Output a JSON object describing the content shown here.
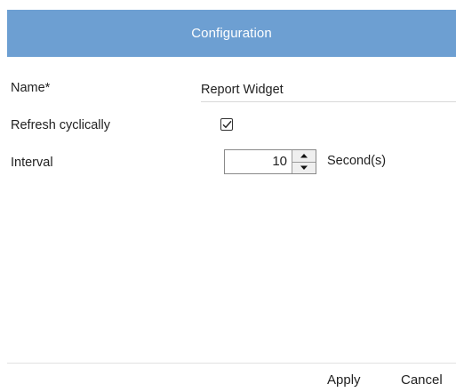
{
  "dialog": {
    "title": "Configuration",
    "header_color": "#6d9fd2"
  },
  "form": {
    "name_label": "Name*",
    "name_value": "Report Widget",
    "refresh_label": "Refresh cyclically",
    "refresh_checked": true,
    "interval_label": "Interval",
    "interval_value": "10",
    "interval_unit": "Second(s)"
  },
  "footer": {
    "apply_label": "Apply",
    "cancel_label": "Cancel"
  },
  "icons": {
    "checkbox": "checkmark-icon",
    "spin_up": "caret-up-icon",
    "spin_down": "caret-down-icon"
  }
}
